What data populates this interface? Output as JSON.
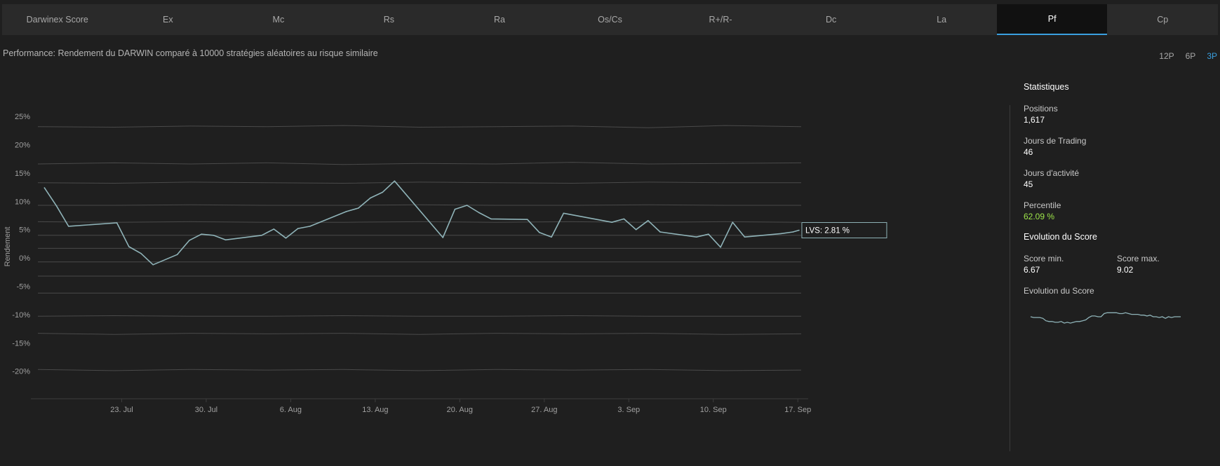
{
  "tabs": [
    {
      "label": "Darwinex Score",
      "active": false
    },
    {
      "label": "Ex",
      "active": false
    },
    {
      "label": "Mc",
      "active": false
    },
    {
      "label": "Rs",
      "active": false
    },
    {
      "label": "Ra",
      "active": false
    },
    {
      "label": "Os/Cs",
      "active": false
    },
    {
      "label": "R+/R-",
      "active": false
    },
    {
      "label": "Dc",
      "active": false
    },
    {
      "label": "La",
      "active": false
    },
    {
      "label": "Pf",
      "active": true
    },
    {
      "label": "Cp",
      "active": false
    }
  ],
  "description": "Performance: Rendement du DARWIN comparé à 10000 stratégies aléatoires au risque similaire",
  "periods": [
    {
      "label": "12P",
      "active": false
    },
    {
      "label": "6P",
      "active": false
    },
    {
      "label": "3P",
      "active": true
    }
  ],
  "chart_data": {
    "type": "line",
    "title": "",
    "xlabel": "",
    "ylabel": "Rendement",
    "ylim": [
      -24,
      27
    ],
    "yticks": [
      "25%",
      "20%",
      "15%",
      "10%",
      "5%",
      "0%",
      "-5%",
      "-10%",
      "-15%",
      "-20%"
    ],
    "ytick_values": [
      25,
      20,
      15,
      10,
      5,
      0,
      -5,
      -10,
      -15,
      -20
    ],
    "xticks": [
      {
        "label": "23. Jul",
        "x": 7
      },
      {
        "label": "30. Jul",
        "x": 14
      },
      {
        "label": "6. Aug",
        "x": 21
      },
      {
        "label": "13. Aug",
        "x": 28
      },
      {
        "label": "20. Aug",
        "x": 35
      },
      {
        "label": "27. Aug",
        "x": 42
      },
      {
        "label": "3. Sep",
        "x": 49
      },
      {
        "label": "10. Sep",
        "x": 56
      },
      {
        "label": "17. Sep",
        "x": 63
      }
    ],
    "xlim": [
      0,
      63.8
    ],
    "series": [
      {
        "name": "LVS",
        "color": "#8fb3b8",
        "points": [
          [
            0.6,
            12.4
          ],
          [
            1.6,
            9.2
          ],
          [
            2.6,
            5.6
          ],
          [
            6.6,
            6.2
          ],
          [
            7.6,
            2.0
          ],
          [
            8.6,
            0.8
          ],
          [
            9.6,
            -1.2
          ],
          [
            11.6,
            0.6
          ],
          [
            12.6,
            3.1
          ],
          [
            13.6,
            4.2
          ],
          [
            14.6,
            4.0
          ],
          [
            15.6,
            3.2
          ],
          [
            18.6,
            4.0
          ],
          [
            19.6,
            5.1
          ],
          [
            20.6,
            3.5
          ],
          [
            21.6,
            5.2
          ],
          [
            22.6,
            5.6
          ],
          [
            25.6,
            8.2
          ],
          [
            26.6,
            8.8
          ],
          [
            27.6,
            10.6
          ],
          [
            28.6,
            11.6
          ],
          [
            29.6,
            13.6
          ],
          [
            33.6,
            3.6
          ],
          [
            34.6,
            8.6
          ],
          [
            35.6,
            9.3
          ],
          [
            36.6,
            8.0
          ],
          [
            37.6,
            6.9
          ],
          [
            40.6,
            6.8
          ],
          [
            41.6,
            4.5
          ],
          [
            42.6,
            3.7
          ],
          [
            43.6,
            7.9
          ],
          [
            47.6,
            6.3
          ],
          [
            48.6,
            6.9
          ],
          [
            49.6,
            5.0
          ],
          [
            50.6,
            6.6
          ],
          [
            51.6,
            4.6
          ],
          [
            54.6,
            3.7
          ],
          [
            55.6,
            4.2
          ],
          [
            56.6,
            1.9
          ],
          [
            57.6,
            6.3
          ],
          [
            58.6,
            3.7
          ],
          [
            61.6,
            4.3
          ],
          [
            62.6,
            4.6
          ],
          [
            63.1,
            4.9
          ]
        ],
        "last_value_label": "LVS: 2.81 %"
      }
    ],
    "percentile_bands": [
      {
        "name": "band-1",
        "values": [
          23.2,
          23.1,
          23.3,
          23.2,
          23.4,
          23.1,
          23.2,
          23.3,
          23.0,
          23.4,
          23.2
        ]
      },
      {
        "name": "band-2",
        "values": [
          16.6,
          16.8,
          16.6,
          16.8,
          16.5,
          16.7,
          16.6,
          16.9,
          16.6,
          16.7,
          16.8
        ]
      },
      {
        "name": "band-3",
        "values": [
          13.3,
          13.2,
          13.4,
          13.3,
          13.2,
          13.4,
          13.3,
          13.2,
          13.4,
          13.3,
          13.3
        ]
      },
      {
        "name": "band-4",
        "values": [
          9.3,
          9.3,
          9.4,
          9.3,
          9.3,
          9.4,
          9.3,
          9.3,
          9.4,
          9.3,
          9.3
        ]
      },
      {
        "name": "band-5",
        "values": [
          6.4,
          6.3,
          6.4,
          6.3,
          6.3,
          6.4,
          6.3,
          6.4,
          6.3,
          6.4,
          6.3
        ]
      },
      {
        "name": "band-6",
        "values": [
          4.0,
          4.0,
          4.0,
          4.0,
          4.0,
          4.0,
          4.0,
          4.0,
          4.0,
          4.0,
          4.0
        ]
      },
      {
        "name": "band-7",
        "values": [
          1.7,
          1.7,
          1.7,
          1.7,
          1.7,
          1.7,
          1.7,
          1.7,
          1.7,
          1.7,
          1.7
        ]
      },
      {
        "name": "band-8",
        "values": [
          -0.7,
          -0.7,
          -0.7,
          -0.7,
          -0.7,
          -0.7,
          -0.7,
          -0.7,
          -0.7,
          -0.7,
          -0.7
        ]
      },
      {
        "name": "band-9",
        "values": [
          -3.2,
          -3.2,
          -3.2,
          -3.2,
          -3.2,
          -3.2,
          -3.2,
          -3.2,
          -3.2,
          -3.2,
          -3.2
        ]
      },
      {
        "name": "band-10",
        "values": [
          -6.2,
          -6.2,
          -6.2,
          -6.2,
          -6.2,
          -6.2,
          -6.2,
          -6.2,
          -6.2,
          -6.2,
          -6.2
        ]
      },
      {
        "name": "band-11",
        "values": [
          -10.3,
          -10.2,
          -10.3,
          -10.3,
          -10.2,
          -10.3,
          -10.3,
          -10.2,
          -10.3,
          -10.3,
          -10.3
        ]
      },
      {
        "name": "band-12",
        "values": [
          -13.3,
          -13.5,
          -13.3,
          -13.4,
          -13.3,
          -13.5,
          -13.3,
          -13.4,
          -13.3,
          -13.5,
          -13.4
        ]
      },
      {
        "name": "band-13",
        "values": [
          -19.7,
          -19.9,
          -19.7,
          -19.8,
          -19.7,
          -19.9,
          -19.7,
          -19.8,
          -19.7,
          -19.9,
          -19.8
        ]
      }
    ],
    "grid": false,
    "legend": "none"
  },
  "stats": {
    "title": "Statistiques",
    "items": [
      {
        "label": "Positions",
        "value": "1,617"
      },
      {
        "label": "Jours de Trading",
        "value": "46"
      },
      {
        "label": "Jours d'activité",
        "value": "45"
      },
      {
        "label": "Percentile",
        "value": "62.09 %",
        "highlight": true
      }
    ]
  },
  "score": {
    "title": "Evolution du Score",
    "min_label": "Score min.",
    "min_value": "6.67",
    "max_label": "Score max.",
    "max_value": "9.02",
    "evolution_label": "Evolution du Score",
    "sparkline": [
      7.5,
      7.4,
      7.4,
      7.4,
      7.3,
      7.0,
      6.9,
      6.9,
      6.8,
      6.8,
      6.9,
      6.7,
      6.8,
      6.7,
      6.8,
      6.9,
      6.9,
      7.0,
      7.1,
      7.4,
      7.6,
      7.6,
      7.5,
      7.5,
      7.9,
      8.0,
      8.0,
      8.0,
      8.0,
      7.9,
      7.9,
      8.0,
      7.9,
      7.8,
      7.8,
      7.8,
      7.7,
      7.7,
      7.6,
      7.7,
      7.5,
      7.5,
      7.4,
      7.5,
      7.3,
      7.5,
      7.4,
      7.5,
      7.5,
      7.5
    ],
    "sparkline_color": "#8fb3b8"
  },
  "colors": {
    "accent": "#3aa0e0",
    "line": "#8fb3b8",
    "band": "#4a4a4a",
    "percentile": "#9ee64a"
  }
}
